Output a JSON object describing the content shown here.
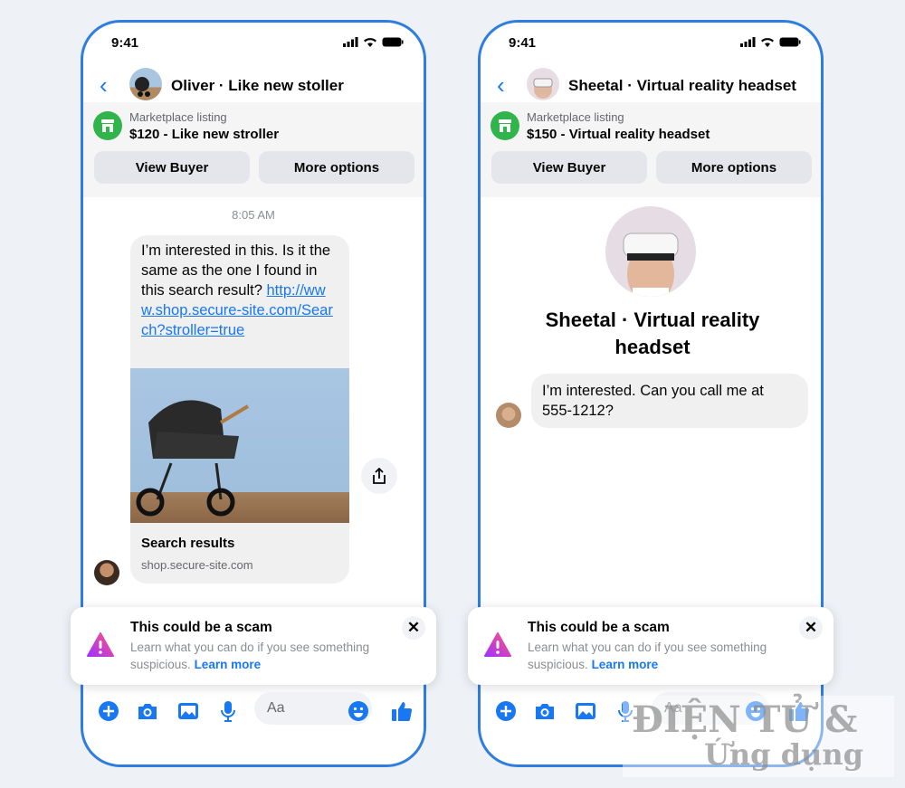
{
  "colors": {
    "accent": "#1877f2",
    "frame": "#2f7de1",
    "marketplace": "#31b44b"
  },
  "phones": [
    {
      "time": "9:41",
      "header_name": "Oliver · Like new stoller",
      "listing_label": "Marketplace listing",
      "listing_price": "$120 - Like new stroller",
      "view_buyer": "View Buyer",
      "more_options": "More options",
      "timestamp": "8:05 AM",
      "message_text": "I’m interested in this. Is it the same as the one I found in this search result?",
      "message_link": "http://www.shop.secure-site.com/Search?stroller=true",
      "link_title": "Search results",
      "link_domain": "shop.secure-site.com"
    },
    {
      "time": "9:41",
      "header_name": "Sheetal · Virtual reality headset",
      "listing_label": "Marketplace listing",
      "listing_price": "$150 - Virtual reality headset",
      "view_buyer": "View Buyer",
      "more_options": "More options",
      "profile_name": "Sheetal · Virtual reality headset",
      "message_text": "I’m interested. Can you call me at 555-1212?"
    }
  ],
  "scam_banner": {
    "title": "This could be a scam",
    "description": "Learn what you can do if you see something suspicious.",
    "link": "Learn more",
    "close": "✕"
  },
  "composer": {
    "placeholder": "Aa",
    "icons": [
      "plus-icon",
      "camera-icon",
      "image-icon",
      "microphone-icon",
      "emoji-icon",
      "thumbs-up-icon"
    ]
  },
  "watermark": {
    "line1": "ĐIỆN TỬ &",
    "line2": "Ứng dụng"
  }
}
